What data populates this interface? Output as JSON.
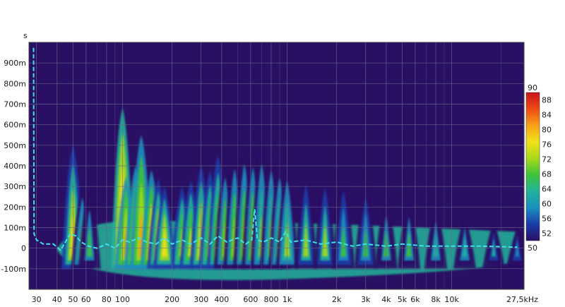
{
  "chart_data": {
    "type": "heatmap",
    "subtype": "spectrogram",
    "y_unit": "s",
    "x_unit_label": "27,5kHz",
    "x_scale": "log",
    "xlim": [
      27,
      27500
    ],
    "ylim": [
      -0.2,
      1.0
    ],
    "x_ticks": [
      {
        "value": 30,
        "label": "30"
      },
      {
        "value": 40,
        "label": "40"
      },
      {
        "value": 50,
        "label": "50"
      },
      {
        "value": 60,
        "label": "60"
      },
      {
        "value": 80,
        "label": "80"
      },
      {
        "value": 100,
        "label": "100"
      },
      {
        "value": 200,
        "label": "200"
      },
      {
        "value": 300,
        "label": "300"
      },
      {
        "value": 400,
        "label": "400"
      },
      {
        "value": 600,
        "label": "600"
      },
      {
        "value": 800,
        "label": "800"
      },
      {
        "value": 1000,
        "label": "1k"
      },
      {
        "value": 2000,
        "label": "2k"
      },
      {
        "value": 3000,
        "label": "3k"
      },
      {
        "value": 4000,
        "label": "4k"
      },
      {
        "value": 5000,
        "label": "5k"
      },
      {
        "value": 6000,
        "label": "6k"
      },
      {
        "value": 8000,
        "label": "8k"
      },
      {
        "value": 10000,
        "label": "10k"
      }
    ],
    "x_minor_ticks": [
      70,
      90,
      500,
      700,
      900,
      7000,
      9000,
      20000
    ],
    "y_ticks": [
      {
        "value": 0.9,
        "label": "900m"
      },
      {
        "value": 0.8,
        "label": "800m"
      },
      {
        "value": 0.7,
        "label": "700m"
      },
      {
        "value": 0.6,
        "label": "600m"
      },
      {
        "value": 0.5,
        "label": "500m"
      },
      {
        "value": 0.4,
        "label": "400m"
      },
      {
        "value": 0.3,
        "label": "300m"
      },
      {
        "value": 0.2,
        "label": "200m"
      },
      {
        "value": 0.1,
        "label": "100m"
      },
      {
        "value": 0.0,
        "label": "0"
      },
      {
        "value": -0.1,
        "label": "-100m"
      }
    ],
    "grid": true,
    "colorbar": {
      "min": 50,
      "max": 90,
      "max_label": "90",
      "min_label": "50",
      "ticks": [
        88,
        84,
        80,
        76,
        72,
        68,
        64,
        60,
        56,
        52
      ],
      "colors": [
        "#2a1065",
        "#1a3ca8",
        "#1a8fbf",
        "#21b39a",
        "#3ec43a",
        "#a8d81c",
        "#f0e21a",
        "#f7a118",
        "#ef4a14",
        "#c8141b"
      ]
    },
    "background_color": "#2a1065",
    "decay_ridges_freq_hz": [
      {
        "f": 50,
        "top": 0.5,
        "level": 78
      },
      {
        "f": 57,
        "top": 0.3,
        "level": 72
      },
      {
        "f": 63,
        "top": 0.32,
        "level": 66
      },
      {
        "f": 100,
        "top": 0.68,
        "level": 84
      },
      {
        "f": 105,
        "top": 0.35,
        "level": 80
      },
      {
        "f": 120,
        "top": 0.4,
        "level": 80
      },
      {
        "f": 130,
        "top": 0.55,
        "level": 80
      },
      {
        "f": 150,
        "top": 0.38,
        "level": 82
      },
      {
        "f": 165,
        "top": 0.34,
        "level": 78
      },
      {
        "f": 180,
        "top": 0.3,
        "level": 78
      },
      {
        "f": 230,
        "top": 0.3,
        "level": 76
      },
      {
        "f": 260,
        "top": 0.33,
        "level": 76
      },
      {
        "f": 300,
        "top": 0.4,
        "level": 77
      },
      {
        "f": 340,
        "top": 0.38,
        "level": 76
      },
      {
        "f": 380,
        "top": 0.45,
        "level": 76
      },
      {
        "f": 420,
        "top": 0.42,
        "level": 74
      },
      {
        "f": 480,
        "top": 0.47,
        "level": 74
      },
      {
        "f": 550,
        "top": 0.5,
        "level": 74
      },
      {
        "f": 620,
        "top": 0.48,
        "level": 73
      },
      {
        "f": 700,
        "top": 0.5,
        "level": 72
      },
      {
        "f": 800,
        "top": 0.46,
        "level": 72
      },
      {
        "f": 900,
        "top": 0.42,
        "level": 72
      },
      {
        "f": 1000,
        "top": 0.4,
        "level": 72
      },
      {
        "f": 1300,
        "top": 0.38,
        "level": 70
      },
      {
        "f": 1700,
        "top": 0.36,
        "level": 70
      },
      {
        "f": 2200,
        "top": 0.34,
        "level": 68
      },
      {
        "f": 3000,
        "top": 0.3,
        "level": 68
      },
      {
        "f": 4000,
        "top": 0.27,
        "level": 66
      },
      {
        "f": 5500,
        "top": 0.26,
        "level": 66
      },
      {
        "f": 8000,
        "top": 0.22,
        "level": 65
      },
      {
        "f": 12000,
        "top": 0.17,
        "level": 64
      },
      {
        "f": 18000,
        "top": 0.14,
        "level": 62
      },
      {
        "f": 25000,
        "top": 0.11,
        "level": 60
      }
    ],
    "decay_line": {
      "color": "#3fe0e8",
      "style": "dashed",
      "points": [
        {
          "f": 28.5,
          "t": 0.97
        },
        {
          "f": 28.8,
          "t": 0.97
        },
        {
          "f": 29.0,
          "t": 0.07
        },
        {
          "f": 30,
          "t": 0.04
        },
        {
          "f": 33,
          "t": 0.02
        },
        {
          "f": 38,
          "t": 0.02
        },
        {
          "f": 42,
          "t": -0.01
        },
        {
          "f": 45,
          "t": 0.03
        },
        {
          "f": 48,
          "t": 0.07
        },
        {
          "f": 52,
          "t": 0.06
        },
        {
          "f": 56,
          "t": 0.03
        },
        {
          "f": 62,
          "t": 0.01
        },
        {
          "f": 70,
          "t": 0.0
        },
        {
          "f": 80,
          "t": 0.02
        },
        {
          "f": 90,
          "t": 0.0
        },
        {
          "f": 100,
          "t": 0.04
        },
        {
          "f": 110,
          "t": 0.03
        },
        {
          "f": 125,
          "t": 0.05
        },
        {
          "f": 140,
          "t": 0.03
        },
        {
          "f": 160,
          "t": 0.02
        },
        {
          "f": 180,
          "t": 0.05
        },
        {
          "f": 200,
          "t": 0.02
        },
        {
          "f": 230,
          "t": 0.04
        },
        {
          "f": 260,
          "t": 0.02
        },
        {
          "f": 300,
          "t": 0.05
        },
        {
          "f": 340,
          "t": 0.02
        },
        {
          "f": 380,
          "t": 0.06
        },
        {
          "f": 430,
          "t": 0.03
        },
        {
          "f": 500,
          "t": 0.05
        },
        {
          "f": 560,
          "t": 0.02
        },
        {
          "f": 610,
          "t": 0.04
        },
        {
          "f": 635,
          "t": 0.19
        },
        {
          "f": 660,
          "t": 0.04
        },
        {
          "f": 720,
          "t": 0.03
        },
        {
          "f": 800,
          "t": 0.05
        },
        {
          "f": 900,
          "t": 0.03
        },
        {
          "f": 980,
          "t": 0.08
        },
        {
          "f": 1050,
          "t": 0.03
        },
        {
          "f": 1300,
          "t": 0.04
        },
        {
          "f": 1600,
          "t": 0.02
        },
        {
          "f": 2000,
          "t": 0.03
        },
        {
          "f": 2500,
          "t": 0.01
        },
        {
          "f": 3000,
          "t": 0.02
        },
        {
          "f": 4000,
          "t": 0.01
        },
        {
          "f": 5000,
          "t": 0.02
        },
        {
          "f": 7000,
          "t": 0.01
        },
        {
          "f": 10000,
          "t": 0.01
        },
        {
          "f": 15000,
          "t": 0.01
        },
        {
          "f": 25000,
          "t": 0.005
        }
      ]
    }
  }
}
